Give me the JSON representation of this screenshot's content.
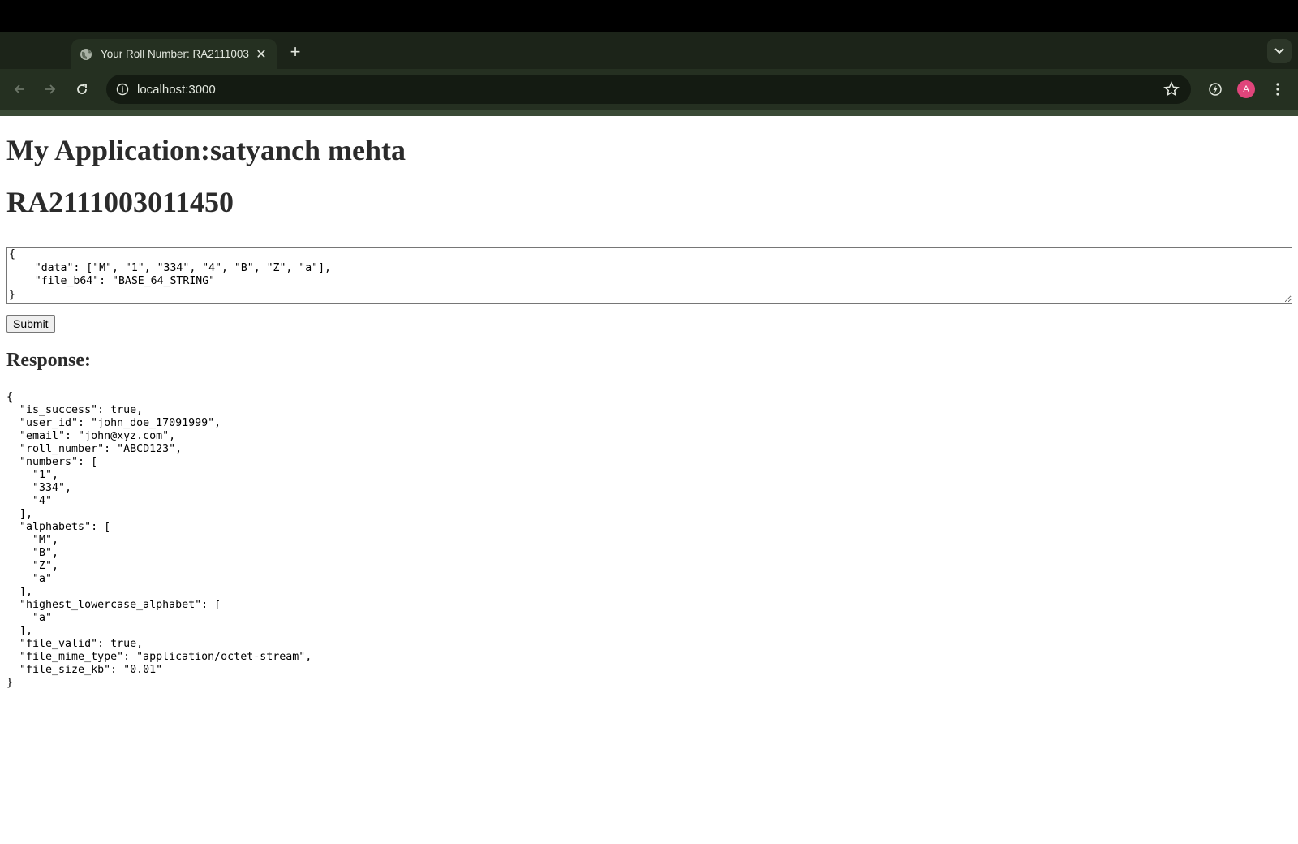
{
  "browser": {
    "tab_title": "Your Roll Number: RA2111003011450",
    "url": "localhost:3000",
    "avatar_letter": "A",
    "icons": [
      "globe-icon",
      "close-icon",
      "plus-icon",
      "chevron-down-icon",
      "back-icon",
      "forward-icon",
      "reload-icon",
      "info-icon",
      "star-icon",
      "performance-icon",
      "avatar",
      "menu-icon"
    ]
  },
  "page": {
    "heading": "My Application:satyanch mehta",
    "roll_number": "RA2111003011450",
    "request_json": "{\n    \"data\": [\"M\", \"1\", \"334\", \"4\", \"B\", \"Z\", \"a\"],\n    \"file_b64\": \"BASE_64_STRING\"\n}",
    "submit_label": "Submit",
    "response_heading": "Response:",
    "response_json": "{\n  \"is_success\": true,\n  \"user_id\": \"john_doe_17091999\",\n  \"email\": \"john@xyz.com\",\n  \"roll_number\": \"ABCD123\",\n  \"numbers\": [\n    \"1\",\n    \"334\",\n    \"4\"\n  ],\n  \"alphabets\": [\n    \"M\",\n    \"B\",\n    \"Z\",\n    \"a\"\n  ],\n  \"highest_lowercase_alphabet\": [\n    \"a\"\n  ],\n  \"file_valid\": true,\n  \"file_mime_type\": \"application/octet-stream\",\n  \"file_size_kb\": \"0.01\"\n}"
  },
  "colors": {
    "tabstrip": "#1c2419",
    "toolbar": "#253021",
    "avatar": "#e0457b"
  }
}
